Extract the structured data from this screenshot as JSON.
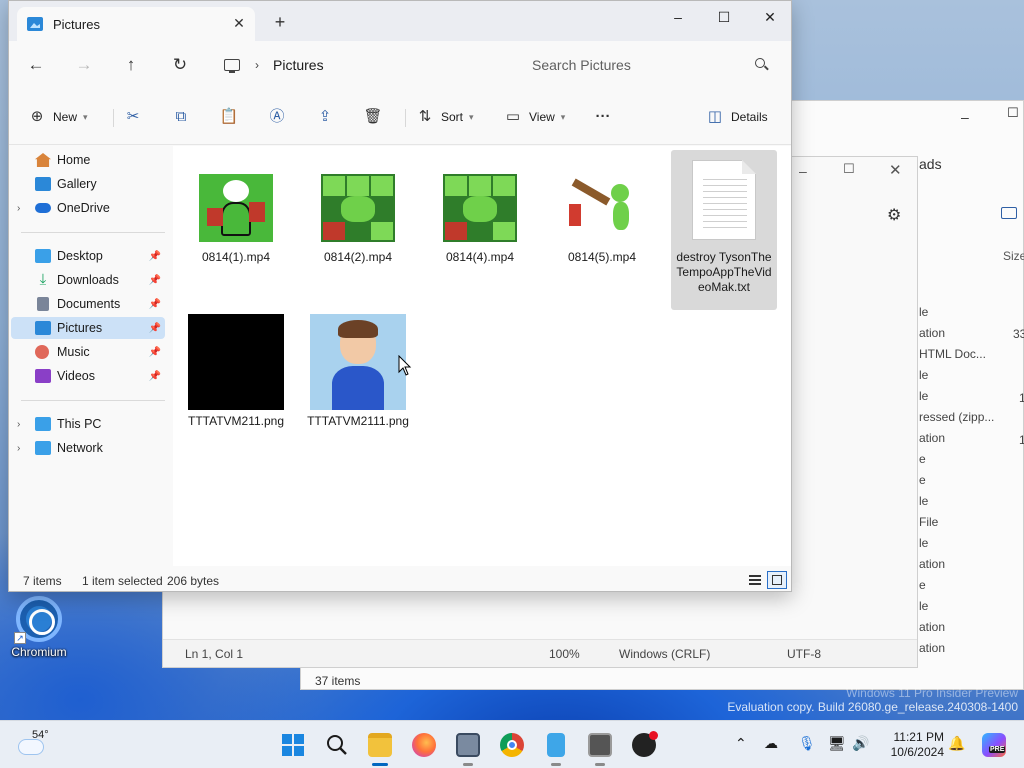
{
  "explorer": {
    "tab_title": "Pictures",
    "breadcrumb": "Pictures",
    "search_placeholder": "Search Pictures",
    "toolbar": {
      "new_label": "New",
      "sort_label": "Sort",
      "view_label": "View",
      "more_label": "···",
      "details_label": "Details"
    },
    "nav": {
      "items": [
        {
          "label": "Home",
          "icon": "home-icon",
          "color": "#d9843b"
        },
        {
          "label": "Gallery",
          "icon": "gallery-icon",
          "color": "#2b88d8"
        },
        {
          "label": "OneDrive",
          "icon": "cloud-icon",
          "color": "#1f6fd6"
        },
        {
          "label": "Desktop",
          "icon": "desktop-icon",
          "color": "#3aa0e8"
        },
        {
          "label": "Downloads",
          "icon": "download-icon",
          "color": "#1aa260"
        },
        {
          "label": "Documents",
          "icon": "document-icon",
          "color": "#7a8599"
        },
        {
          "label": "Pictures",
          "icon": "picture-icon",
          "color": "#2b88d8"
        },
        {
          "label": "Music",
          "icon": "music-icon",
          "color": "#e0685a"
        },
        {
          "label": "Videos",
          "icon": "video-icon",
          "color": "#8a3fc7"
        },
        {
          "label": "This PC",
          "icon": "pc-icon",
          "color": "#3aa0e8"
        },
        {
          "label": "Network",
          "icon": "network-icon",
          "color": "#3aa0e8"
        }
      ]
    },
    "files": [
      {
        "name": "0814(1).mp4"
      },
      {
        "name": "0814(2).mp4"
      },
      {
        "name": "0814(4).mp4"
      },
      {
        "name": "0814(5).mp4"
      },
      {
        "name": "destroy TysonTheTempoAppTheVideoMak.txt"
      },
      {
        "name": "TTTATVM211.png"
      },
      {
        "name": "TTTATVM2111.png"
      }
    ],
    "status": {
      "count": "7 items",
      "selection": "1 item selected",
      "size": "206 bytes"
    }
  },
  "notepad": {
    "position": "Ln 1, Col 1",
    "zoom": "100%",
    "line_ending": "Windows (CRLF)",
    "encoding": "UTF-8"
  },
  "downloads": {
    "title_fragment": "ads",
    "column_fragment": "Size",
    "count": "37 items",
    "type_fragments": [
      "le",
      "ation",
      "HTML Doc...",
      "le",
      "le",
      "ressed (zipp...",
      "ation",
      "e",
      "e",
      "le",
      "File",
      "le",
      "ation",
      "e",
      "le",
      "ation",
      "ation"
    ],
    "size_fragments": [
      "33",
      "1",
      "1"
    ]
  },
  "desktop": {
    "icon_label": "Chromium",
    "watermark_line1": "Windows 11 Pro Insider Preview",
    "watermark_line2": "Evaluation copy. Build 26080.ge_release.240308-1400"
  },
  "taskbar": {
    "temperature": "54°",
    "time": "11:21 PM",
    "date": "10/6/2024",
    "copilot_badge": "PRE"
  }
}
